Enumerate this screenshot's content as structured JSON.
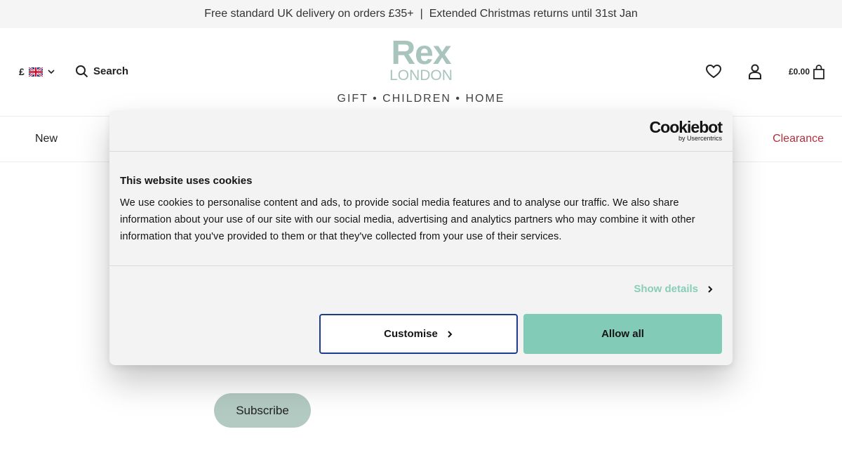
{
  "announcement": {
    "delivery": "Free standard UK delivery on orders £35+",
    "separator": "|",
    "returns": "Extended Christmas returns until 31st Jan"
  },
  "header": {
    "currency_symbol": "£",
    "country_flag": "uk-flag-icon",
    "search_label": "Search",
    "logo_line1": "Rex",
    "logo_line2": "LONDON",
    "tagline": "GIFT • CHILDREN • HOME",
    "basket_total": "£0.00"
  },
  "nav": {
    "items": [
      "New",
      "Clearance"
    ]
  },
  "newsletter": {
    "subscribe_label": "Subscribe"
  },
  "cookie_dialog": {
    "brand": "Cookiebot",
    "brand_sub": "by Usercentrics",
    "title": "This website uses cookies",
    "body": "We use cookies to personalise content and ads, to provide social media features and to analyse our traffic. We also share information about your use of our site with our social media, advertising and analytics partners who may combine it with other information that you've provided to them or that they've collected from your use of their services.",
    "show_details_label": "Show details",
    "customise_label": "Customise",
    "allow_all_label": "Allow all"
  },
  "colors": {
    "accent_green": "#82ccb7",
    "logo_sage": "#a8c4bd",
    "clearance_red": "#b0303c",
    "customise_border": "#1f3c8c"
  }
}
